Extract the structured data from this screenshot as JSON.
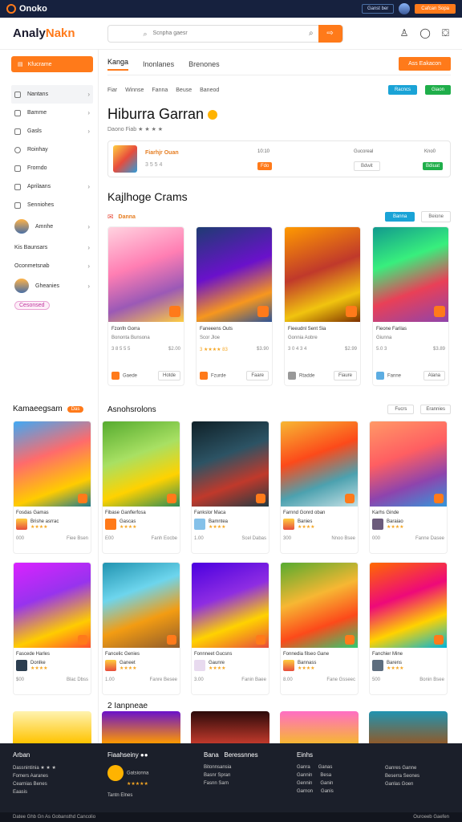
{
  "topbar": {
    "brand": "Onoko",
    "btn_blue": "Ganst ber",
    "btn_orange": "Cafcan Sopa"
  },
  "header": {
    "logo_a": "Analy",
    "logo_b": "Nakn",
    "search_placeholder": "Scnpha gaesr"
  },
  "sidebar": {
    "primary": "Kfucrame",
    "items": [
      {
        "label": "Nantans"
      },
      {
        "label": "Bamme"
      },
      {
        "label": "Gasls"
      },
      {
        "label": "Roinhay"
      },
      {
        "label": "Frorndo"
      },
      {
        "label": "Aprilaans"
      },
      {
        "label": "Senniohes"
      },
      {
        "label": "Amnhe"
      },
      {
        "label": "Kis Baunsars"
      },
      {
        "label": "Oconmetsnab"
      },
      {
        "label": "Gheanies"
      }
    ],
    "pill": "Cesonsed"
  },
  "tabs": [
    {
      "label": "Kanga"
    },
    {
      "label": "Inonlanes"
    },
    {
      "label": "Brenones"
    }
  ],
  "tabs_cta": "Ass Eakacon",
  "filters": [
    "Fiar",
    "Winnse",
    "Fanna",
    "Beuse",
    "Baneod"
  ],
  "filter_blue": "Racncs",
  "filter_green": "Giaon",
  "title": "Hiburra Garran",
  "subtitle": "Daono Fiab ★ ★ ★ ★",
  "featured": {
    "title": "Fiarhjr Ouan",
    "sub": "3 5 5 4",
    "c1": "10:10",
    "c2": "Gucoreal",
    "c3": "Kno0",
    "btn_orange": "Fdo",
    "btn_grey": "Bdwit",
    "btn_green": "Bdiuat"
  },
  "section_title": "Kajlhoge Crams",
  "section_label": "Danna",
  "section_btn_blue": "Banna",
  "section_btn_grey": "Beione",
  "cards": [
    {
      "n1": "Fzonfn Gorra",
      "n2": "Bononta Bunsona",
      "l": "3 8 5 5 5",
      "r": "$2.00",
      "b": "Gaede",
      "c": "Hotde"
    },
    {
      "n1": "Faneeens Outs",
      "n2": "Scor Jloe",
      "l": "3 ★★★★ 83",
      "r": "$3.90",
      "b": "Fzurde",
      "c": "Faare"
    },
    {
      "n1": "Fieeudnl Sent Sia",
      "n2": "Gonnia Aobre",
      "l": "3 0 4 3 4",
      "r": "$2.99",
      "b": "Rtadde",
      "c": "Fiaure"
    },
    {
      "n1": "Fieone Farilas",
      "n2": "Giunna",
      "l": "5.0 3",
      "r": "$3.89",
      "b": "Fanne",
      "c": "Alana"
    }
  ],
  "sec2_left": "Kamaeegsam",
  "sec2_hot": "Das",
  "sec2_title": "Asnohsrolons",
  "sec2_btn1": "Fucrs",
  "sec2_btn2": "Erannies",
  "cards2": [
    {
      "n": "Fosdas Gamas",
      "a": "Brishe asrrac",
      "s": "★★★★",
      "l": "000",
      "r": "Fiee Bsen"
    },
    {
      "n": "Fibase Ganflerfosa",
      "a": "Gascas",
      "s": "★★★★",
      "l": "E00",
      "r": "Fanh Eocbe"
    },
    {
      "n": "Fankslor Maca",
      "a": "Bamntea",
      "s": "★★★★",
      "l": "1.00",
      "r": "Scel Dabas"
    },
    {
      "n": "Farnnd Gonrd oban",
      "a": "Banies",
      "s": "★★★★",
      "l": "300",
      "r": "Nnoo Bsee"
    },
    {
      "n": "Karhs Ginde",
      "a": "Baraiao",
      "s": "★★★★",
      "l": "000",
      "r": "Fanne Dasee"
    },
    {
      "n": "Fascede Harles",
      "a": "Donlke",
      "s": "★★★★",
      "l": "$00",
      "r": "Blac Dbss"
    },
    {
      "n": "Fancelic Genies",
      "a": "Ganeet",
      "s": "★★★★",
      "l": "1.00",
      "r": "Fanre Besee"
    },
    {
      "n": "Fonnneet Gucsns",
      "a": "Gaunre",
      "s": "★★★★",
      "l": "3.00",
      "r": "Fanin Baee"
    },
    {
      "n": "Fonnedia filseo Gane",
      "a": "Bannass",
      "s": "★★★★",
      "l": "8.00",
      "r": "Fane Gsseec"
    },
    {
      "n": "Fanchier Mine",
      "a": "Barens",
      "s": "★★★★",
      "l": "500",
      "r": "Bonin Bsee"
    }
  ],
  "sec3_title": "2 Ianpneae",
  "footer": {
    "c1": {
      "h": "Arban",
      "l1": "Dassnintinia ★ ★ ★",
      "l2": "Fomers Aaranes",
      "l3": "Cearnias Benes",
      "l4": "Eaasis"
    },
    "c2": {
      "h": "Fiaahseiny ●●",
      "t": "Gatsionna",
      "s": "★★★★★",
      "l": "Tantn Elnes"
    },
    "c3": {
      "h": "Bana",
      "h2": "Beressnnes",
      "t": "Bitonnsansia",
      "l": "Basnr Spran",
      "l2": "Fasnn Sarn"
    },
    "c4": {
      "h": "Einhs",
      "a": "Ganra",
      "b": "Ganas",
      "c": "Gannin",
      "d": "Besa",
      "e": "Gennin",
      "f": "Ganin",
      "g": "Garnon",
      "h2": "Ganis"
    },
    "c5": {
      "t1": "Ganres Ganne",
      "t2": "Beserra Seones",
      "t3": "Ganlas Goen"
    }
  },
  "bottombar": {
    "l": "Datee Ghb Gn As Gobansthd Cancolio",
    "r": "Ouroeeb Gaefen"
  }
}
